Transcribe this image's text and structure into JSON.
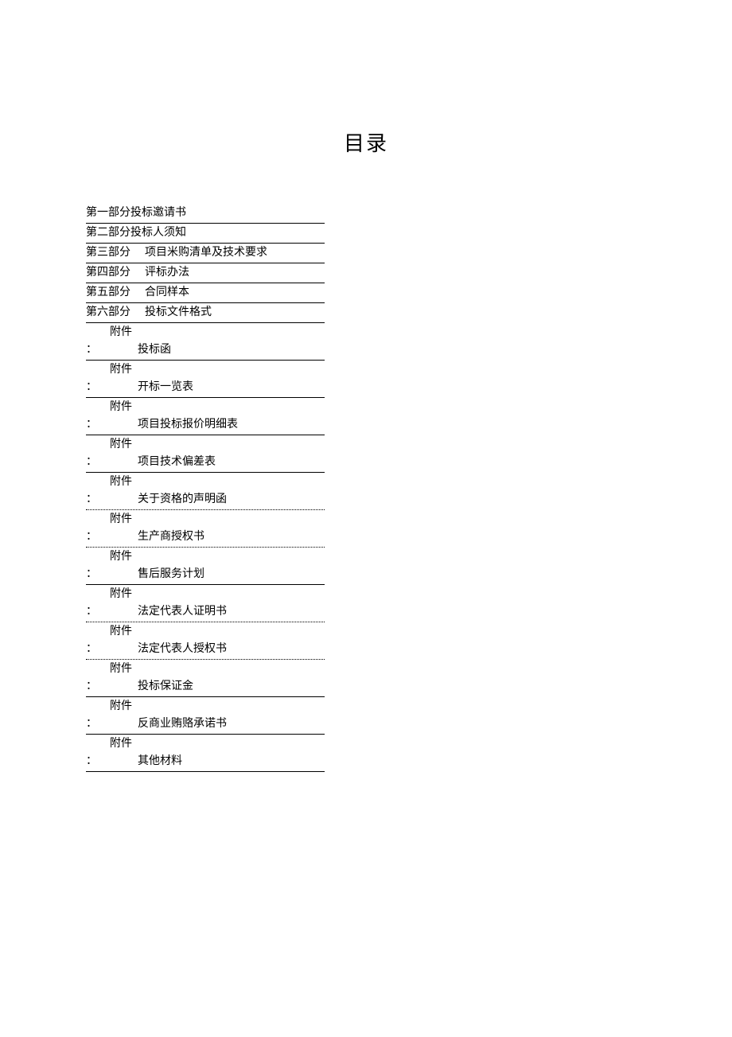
{
  "title": "目录",
  "parts": [
    {
      "part": "第一部分",
      "label": "投标邀请书",
      "gap": false
    },
    {
      "part": "第二部分",
      "label": "投标人须知",
      "gap": false
    },
    {
      "part": "第三部分",
      "label": "项目米购清单及技术要求",
      "gap": true
    },
    {
      "part": "第四部分",
      "label": "评标办法",
      "gap": true
    },
    {
      "part": "第五部分",
      "label": "合同样本",
      "gap": true
    },
    {
      "part": "第六部分",
      "label": "投标文件格式",
      "gap": true
    }
  ],
  "attach_prefix": "附件",
  "colon": "：",
  "attachments": [
    {
      "label": "投标函",
      "dotted": false
    },
    {
      "label": "开标一览表",
      "dotted": false
    },
    {
      "label": "项目投标报价明细表",
      "dotted": false
    },
    {
      "label": "项目技术偏差表",
      "dotted": false
    },
    {
      "label": "关于资格的声明函",
      "dotted": true
    },
    {
      "label": "生产商授权书",
      "dotted": true
    },
    {
      "label": "售后服务计划",
      "dotted": false
    },
    {
      "label": "法定代表人证明书",
      "dotted": true
    },
    {
      "label": "法定代表人授权书",
      "dotted": true
    },
    {
      "label": "投标保证金",
      "dotted": false
    },
    {
      "label": "反商业贿赂承诺书",
      "dotted": false
    },
    {
      "label": "其他材料",
      "dotted": false
    }
  ]
}
